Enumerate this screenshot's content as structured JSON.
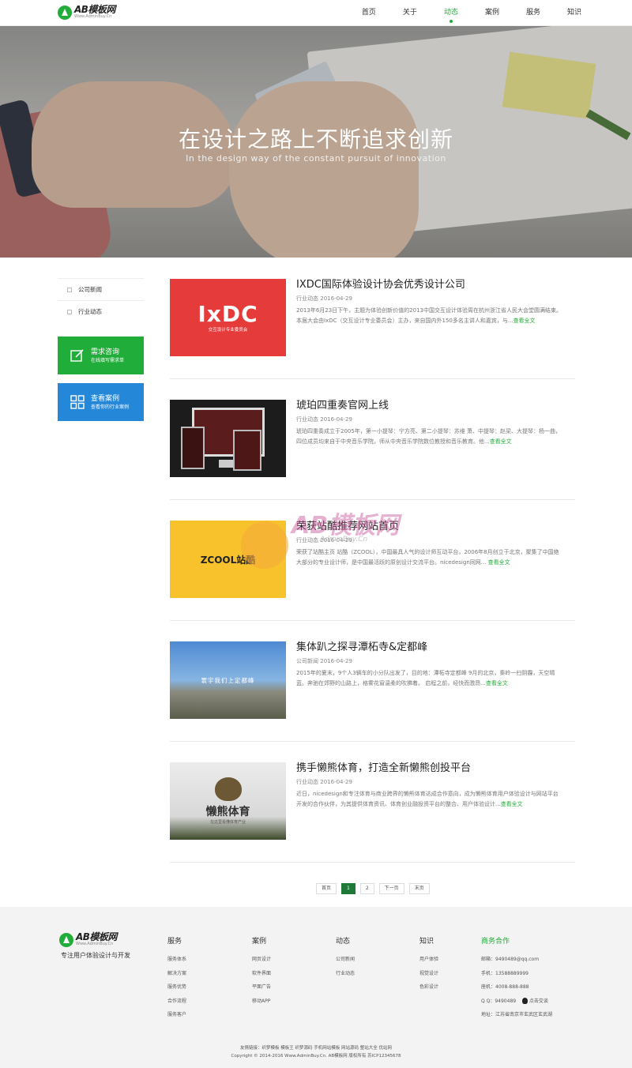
{
  "header": {
    "logo_name": "AB模板网",
    "logo_url": "Www.AdminBuy.Cn",
    "nav": [
      "首页",
      "关于",
      "动态",
      "案例",
      "服务",
      "知识"
    ],
    "active_nav": "动态"
  },
  "banner": {
    "title": "在设计之路上不断追求创新",
    "subtitle": "In the design way of the constant pursuit of innovation"
  },
  "sidebar": {
    "categories": [
      "公司新闻",
      "行业动态"
    ],
    "btn_demand": {
      "title": "需求咨询",
      "sub": "在线填写需求单"
    },
    "btn_cases": {
      "title": "查看案例",
      "sub": "查看你的行业案例"
    }
  },
  "articles": [
    {
      "title": "IXDC国际体验设计协会优秀设计公司",
      "category": "行业动态",
      "date": "2016-04-29",
      "desc": "2013年6月23日下午，主题为体验创新价值的2013中国交互设计体验周在杭州浙江省人民大会堂圆满结束。本届大会由IxDC（交互设计专业委员会）主办，来自国内外150多名主讲人和嘉宾，与...",
      "more": "查看全文",
      "thumb_text": "IxDC",
      "thumb_sub": "交互设计专业委员会"
    },
    {
      "title": "琥珀四重奏官网上线",
      "category": "行业动态",
      "date": "2016-04-29",
      "desc": "琥珀四重奏成立于2005年，第一小提琴：宁方亮、第二小提琴：苏维 萧、中提琴：赵梁、大提琴：杨一曲，四位成员均来自于中央音乐学院，师从中央音乐学院数位教授和音乐教育。他...",
      "more": "查看全文"
    },
    {
      "title": "荣获站酷推荐网站首页",
      "category": "行业动态",
      "date": "2016-04-29",
      "desc": "荣获了站酷主页 站酷（ZCOOL），中国最具人气的设计师互动平台，2006年8月创立于北京，聚集了中国绝大部分的专业设计师，是中国最活跃的原创设计交流平台。nicedesign同网... ",
      "more": "查看全文",
      "thumb_text": "ZCOOL站酷"
    },
    {
      "title": "集体趴之探寻潭柘寺&定都峰",
      "category": "公司新闻",
      "date": "2016-04-29",
      "desc": "2015年的夏末，9个人3辆车的小分队出发了，目的地：潭柘寺定都峰 9月的北京，秦岭一扫阴霾，天空晴蓝。奔驰在郊野的山路上，格雾花窗温柔的吹拂着。 启程之前，经快而激昂...",
      "more": "查看全文",
      "thumb_text": "寰宇我们上定都峰"
    },
    {
      "title": "携手懒熊体育，打造全新懒熊创投平台",
      "category": "行业动态",
      "date": "2016-04-29",
      "desc": "近日，nicedesign和专注体育与商业跨界的懒熊体育达成合作意向，成为懒熊体育用户体验设计与网站平台开发的合作伙伴，为其提供体育资讯、体育创业融投资平台的整合、用户体验设计...",
      "more": "查看全文",
      "thumb_text": "懒熊体育",
      "thumb_sub": "在这里看懂体育产业"
    }
  ],
  "watermark": {
    "text": "AB模板网",
    "url": "AdminBuy.Cn"
  },
  "pagination": [
    "首页",
    "1",
    "2",
    "下一页",
    "末页"
  ],
  "pagination_current": "1",
  "footer": {
    "slogan": "专注用户体验设计与开发",
    "columns": [
      {
        "title": "服务",
        "items": [
          "服务体系",
          "解决方案",
          "服务优势",
          "合作流程",
          "服务客户"
        ]
      },
      {
        "title": "案例",
        "items": [
          "网页设计",
          "软件界面",
          "平面广告",
          "移动APP"
        ]
      },
      {
        "title": "动态",
        "items": [
          "公司新闻",
          "行业动态"
        ]
      },
      {
        "title": "知识",
        "items": [
          "用户体验",
          "视觉设计",
          "色彩设计"
        ]
      }
    ],
    "contact": {
      "title": "商务合作",
      "items": [
        "邮箱：9490489@qq.com",
        "手机：13588889999",
        "座机：4008-888-888",
        "Q Q：9490489",
        "地址：江苏省南京市玄武区玄武湖"
      ],
      "qq_button": "点击交谈"
    },
    "links_line": "友情链接：织梦模板 模板王 织梦源码 手机网站模板 网站源码 整站大全 优站网",
    "copyright": "Copyright © 2014-2016 Www.AdminBuy.Cn. AB模板网 版权所有 苏ICP12345678"
  },
  "colors": {
    "accent": "#21ad3a",
    "blue": "#2487d8"
  }
}
